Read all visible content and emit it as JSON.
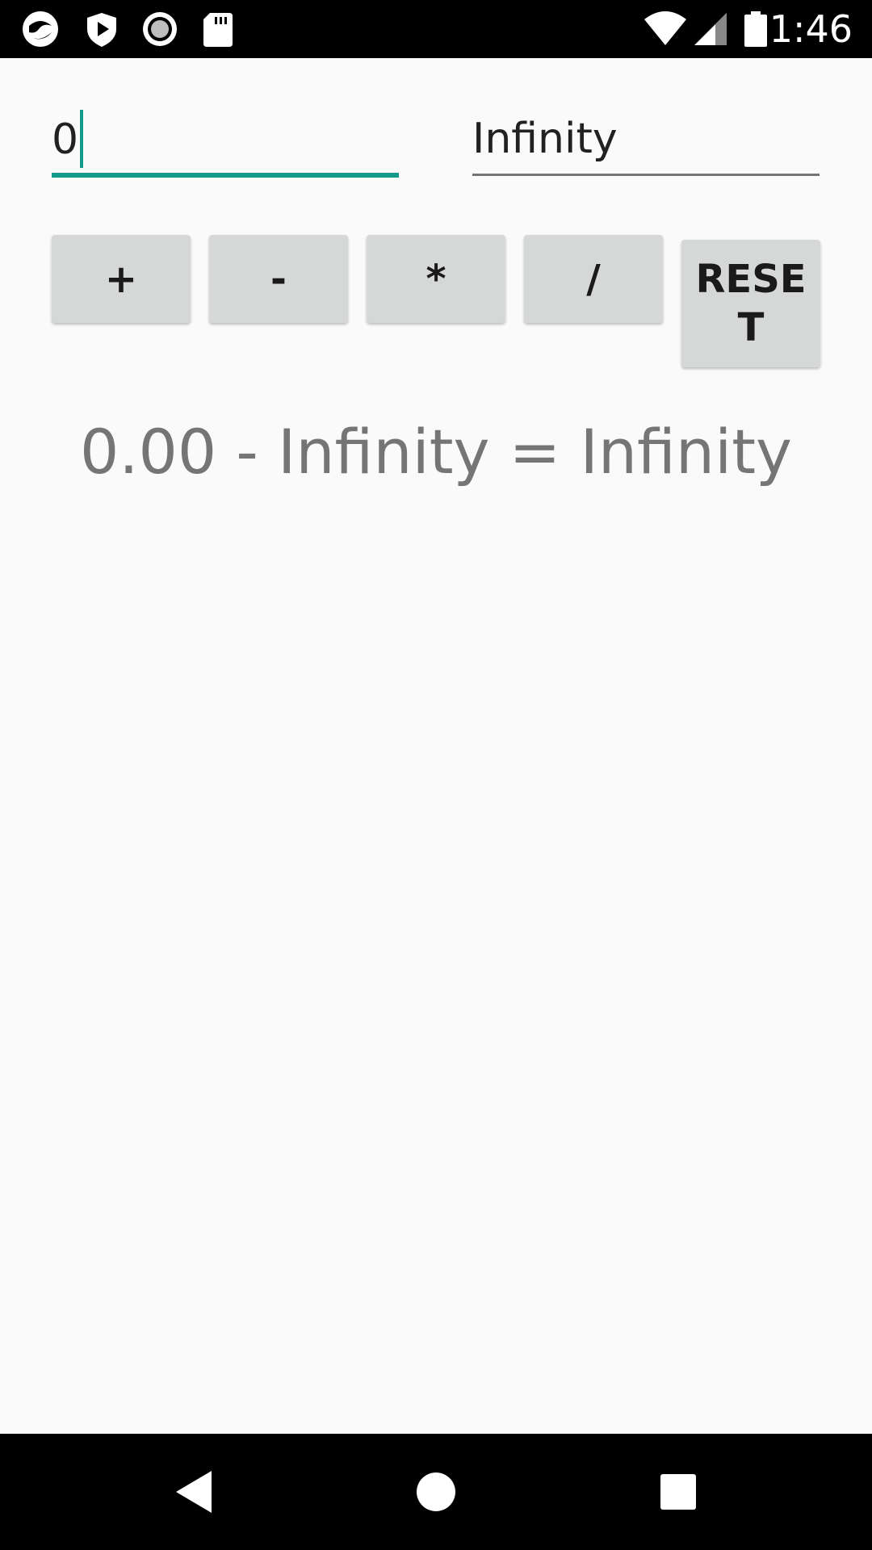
{
  "status_bar": {
    "time": "1:46",
    "left_icons": [
      "app-icon",
      "shield-play-icon",
      "record-icon",
      "sd-card-icon"
    ],
    "right_icons": [
      "wifi-icon",
      "cell-signal-icon",
      "battery-icon"
    ]
  },
  "inputs": {
    "first_value": "0",
    "second_value": "Infinity"
  },
  "buttons": {
    "add": "+",
    "subtract": "-",
    "multiply": "*",
    "divide": "/",
    "reset": "RESET"
  },
  "result_text": "0.00 - Infinity = Infinity",
  "colors": {
    "accent": "#14998a",
    "button_bg": "#d6d7d7",
    "result_text": "#757575"
  },
  "nav_bar": {
    "icons": [
      "back-icon",
      "home-icon",
      "recents-icon"
    ]
  }
}
